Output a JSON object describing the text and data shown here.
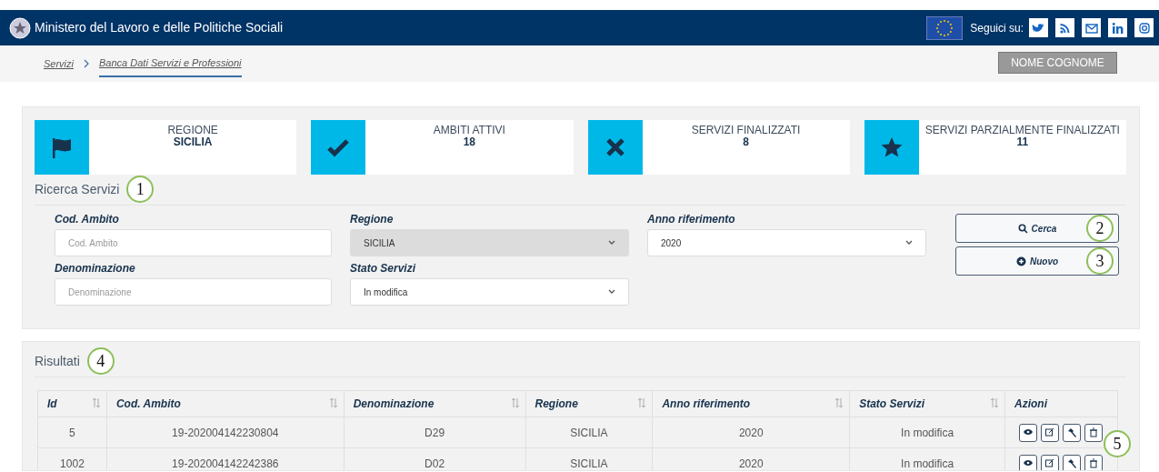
{
  "header": {
    "title": "Ministero del Lavoro e delle Politiche Sociali",
    "follow_label": "Seguici su:",
    "social_links": [
      {
        "kind": "twitter"
      },
      {
        "kind": "rss"
      },
      {
        "kind": "mail"
      },
      {
        "kind": "linkedin"
      },
      {
        "kind": "instagram"
      }
    ]
  },
  "breadcrumb": [
    {
      "label": "Servizi",
      "selected": false
    },
    {
      "label": "Banca Dati Servizi e Professioni",
      "selected": true
    }
  ],
  "user_button": "NOME COGNOME",
  "stats": [
    {
      "kind": "flag",
      "label": "REGIONE",
      "value": "SICILIA"
    },
    {
      "kind": "check",
      "label": "AMBITI ATTIVI",
      "value": "18"
    },
    {
      "kind": "times",
      "label": "SERVIZI FINALIZZATI",
      "value": "8"
    },
    {
      "kind": "star",
      "label": "SERVIZI PARZIALMENTE FINALIZZATI",
      "value": "11"
    }
  ],
  "search": {
    "title": "Ricerca Servizi",
    "callout": "1",
    "fields": [
      {
        "kind": "input",
        "label": "Cod. Ambito",
        "placeholder": "Cod. Ambito",
        "disabled": false
      },
      {
        "kind": "select",
        "label": "Regione",
        "value": "SICILIA",
        "disabled": true
      },
      {
        "kind": "select",
        "label": "Anno riferimento",
        "value": "2020",
        "disabled": false
      },
      {
        "kind": "input",
        "label": "Denominazione",
        "placeholder": "Denominazione",
        "disabled": false
      },
      {
        "kind": "select",
        "label": "Stato Servizi",
        "value": "In modifica",
        "disabled": false
      }
    ],
    "buttons": [
      {
        "kind": "search",
        "label": "Cerca",
        "callout": "2"
      },
      {
        "kind": "add",
        "label": "Nuovo",
        "callout": "3"
      }
    ]
  },
  "results": {
    "title": "Risultati",
    "callout": "4",
    "actions_callout": "5",
    "columns": [
      {
        "label": "Id",
        "sortable": true
      },
      {
        "label": "Cod. Ambito",
        "sortable": true
      },
      {
        "label": "Denominazione",
        "sortable": true
      },
      {
        "label": "Regione",
        "sortable": true
      },
      {
        "label": "Anno riferimento",
        "sortable": true
      },
      {
        "label": "Stato Servizi",
        "sortable": true
      },
      {
        "label": "Azioni",
        "sortable": false
      }
    ],
    "rows": [
      {
        "cells": [
          "5",
          "19-202004142230804",
          "D29",
          "SICILIA",
          "2020",
          "In modifica"
        ],
        "actions": [
          {
            "kind": "view"
          },
          {
            "kind": "edit"
          },
          {
            "kind": "tool"
          },
          {
            "kind": "delete"
          }
        ]
      },
      {
        "cells": [
          "1002",
          "19-202004142242386",
          "D02",
          "SICILIA",
          "2020",
          "In modifica"
        ],
        "actions": [
          {
            "kind": "view"
          },
          {
            "kind": "edit"
          },
          {
            "kind": "tool"
          },
          {
            "kind": "delete"
          }
        ]
      }
    ]
  }
}
